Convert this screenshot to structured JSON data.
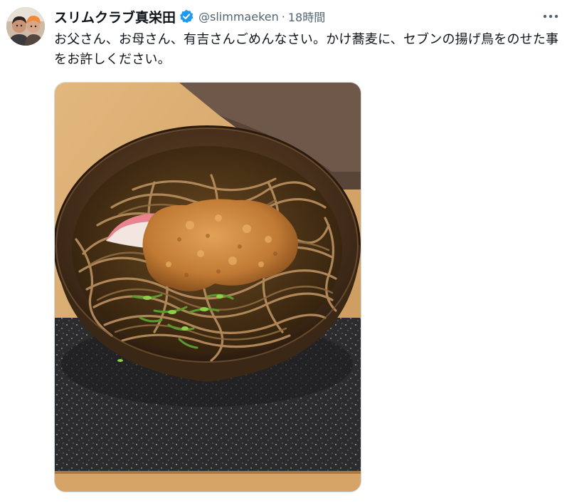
{
  "tweet": {
    "author_name": "スリムクラブ真栄田",
    "handle": "@slimmaeken",
    "separator": "·",
    "time": "18時間",
    "text": "お父さん、お母さん、有吉さんごめんなさい。かけ蕎麦に、セブンの揚げ鳥をのせた事をお許しください。",
    "icons": {
      "verified": "verified-badge-icon",
      "more": "more-options-icon"
    },
    "colors": {
      "text": "#0f1419",
      "secondary": "#536471",
      "verified": "#1d9bf0"
    }
  }
}
